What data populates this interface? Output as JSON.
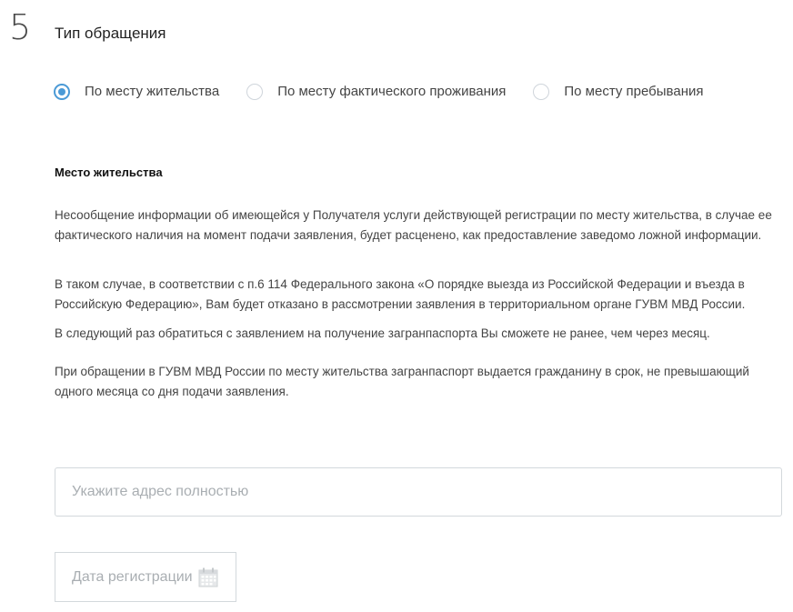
{
  "step": {
    "number": "5",
    "title": "Тип обращения"
  },
  "request_type": {
    "options": [
      {
        "label": "По месту жительства",
        "selected": true
      },
      {
        "label": "По месту фактического проживания",
        "selected": false
      },
      {
        "label": "По месту пребывания",
        "selected": false
      }
    ]
  },
  "info": {
    "heading": "Место жительства",
    "paragraphs": [
      "Несообщение информации об имеющейся у Получателя услуги действующей регистрации по месту жительства, в случае ее фактического наличия на момент подачи заявления, будет расценено, как предоставление заведомо ложной информации.",
      "В таком случае, в соответствии с п.6 114 Федерального закона «О порядке выезда из Российской Федерации и въезда в Российскую Федерацию», Вам будет отказано в рассмотрении заявления в территориальном органе ГУВМ МВД России.",
      "В следующий раз обратиться с заявлением на получение загранпаспорта Вы сможете не ранее, чем через месяц.",
      "При обращении в ГУВМ МВД России по месту жительства загранпаспорт выдается гражданину в срок, не превышающий одного месяца со дня подачи заявления."
    ]
  },
  "address_input": {
    "placeholder": "Укажите адрес полностью",
    "value": ""
  },
  "registration_date": {
    "label": "Дата регистрации",
    "icon": "calendar-icon"
  },
  "colors": {
    "accent": "#4b9ad6",
    "border": "#d3d8dc",
    "placeholder": "#a9aeb2",
    "text": "#444444"
  }
}
